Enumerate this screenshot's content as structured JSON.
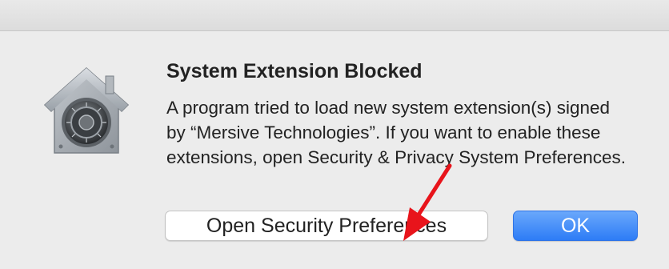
{
  "dialog": {
    "title": "System Extension Blocked",
    "message": "A program tried to load new system extension(s) signed by “Mersive Technologies”.  If you want to enable these extensions, open Security & Privacy System Preferences.",
    "icon": "security-vault-house-icon",
    "buttons": {
      "secondary_label": "Open Security Preferences",
      "primary_label": "OK"
    }
  },
  "annotation": {
    "icon": "red-arrow-icon",
    "color": "#e8141b"
  },
  "colors": {
    "primary_button": "#2d7cf6",
    "background": "#ececec"
  }
}
